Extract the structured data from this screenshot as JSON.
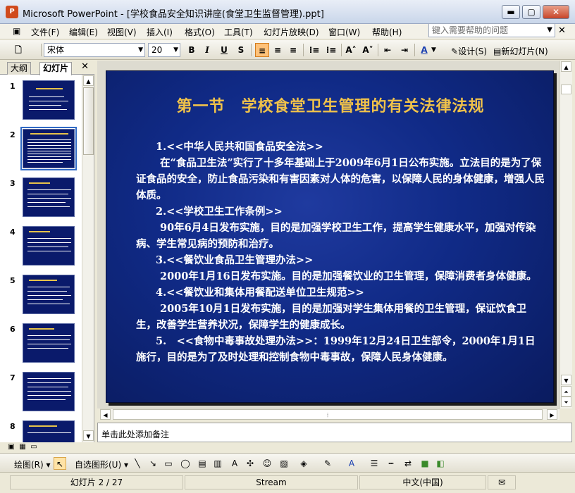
{
  "window": {
    "title": "Microsoft PowerPoint - [学校食品安全知识讲座(食堂卫生监督管理).ppt]",
    "app_icon": "P"
  },
  "menu": {
    "items": [
      "文件(F)",
      "编辑(E)",
      "视图(V)",
      "插入(I)",
      "格式(O)",
      "工具(T)",
      "幻灯片放映(D)",
      "窗口(W)",
      "帮助(H)"
    ],
    "help_placeholder": "键入需要帮助的问题"
  },
  "toolbar": {
    "font_name": "宋体",
    "font_size": "20",
    "bold": "B",
    "italic": "I",
    "underline": "U",
    "shadow": "S",
    "design_label": "设计(S)",
    "new_slide_label": "新幻灯片(N)"
  },
  "pane_tabs": {
    "outline": "大纲",
    "slides": "幻灯片"
  },
  "thumbnails": [
    {
      "num": "1"
    },
    {
      "num": "2"
    },
    {
      "num": "3"
    },
    {
      "num": "4"
    },
    {
      "num": "5"
    },
    {
      "num": "6"
    },
    {
      "num": "7"
    },
    {
      "num": "8"
    }
  ],
  "slide": {
    "title": "第一节　学校食堂卫生管理的有关法律法规",
    "paragraphs": [
      "1.<<中华人民共和国食品安全法>>",
      "在“食品卫生法”实行了十多年基础上于2009年6月1日公布实施。立法目的是为了保证食品的安全，防止食品污染和有害因素对人体的危害，以保障人民的身体健康，增强人民体质。",
      "2.<<学校卫生工作条例>>",
      "90年6月4日发布实施，目的是加强学校卫生工作，提高学生健康水平，加强对传染病、学生常见病的预防和治疗。",
      "3.<<餐饮业食品卫生管理办法>>",
      "2000年1月16日发布实施。目的是加强餐饮业的卫生管理，保障消费者身体健康。",
      "4.<<餐饮业和集体用餐配送单位卫生规范>>",
      "2005年10月1日发布实施，目的是加强对学生集体用餐的卫生管理，保证饮食卫生，改善学生营养状况，保障学生的健康成长。",
      "5.　<<食物中毒事故处理办法>>：1999年12月24日卫生部令，2000年1月1日施行，目的是为了及时处理和控制食物中毒事故，保障人民身体健康。"
    ]
  },
  "notes": {
    "placeholder": "单击此处添加备注"
  },
  "drawbar": {
    "draw_label": "绘图(R)",
    "autoshape_label": "自选图形(U)"
  },
  "status": {
    "slide_pos": "幻灯片 2 / 27",
    "template": "Stream",
    "language": "中文(中国)"
  },
  "colors": {
    "slide_bg": "#102a86",
    "slide_title": "#f0c24a",
    "slide_text": "#ffffff"
  }
}
